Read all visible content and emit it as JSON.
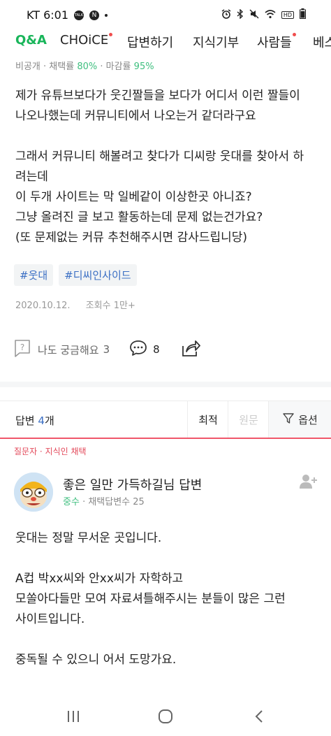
{
  "status_bar": {
    "carrier_time": "KT 6:01",
    "app_icons": [
      "TALK",
      "N"
    ],
    "right_icons": [
      "alarm-icon",
      "bluetooth-icon",
      "mute-icon",
      "wifi-icon",
      "hd-icon",
      "battery-icon"
    ],
    "hd_label": "HD"
  },
  "tabs": [
    {
      "label": "Q&A",
      "active": true,
      "dot": false
    },
    {
      "label": "CHOiCE",
      "active": false,
      "dot": true
    },
    {
      "label": "답변하기",
      "active": false,
      "dot": false
    },
    {
      "label": "지식기부",
      "active": false,
      "dot": false
    },
    {
      "label": "사람들",
      "active": false,
      "dot": true
    },
    {
      "label": "베스",
      "active": false,
      "dot": false
    }
  ],
  "question_stats": {
    "visibility": "비공개",
    "adoption_label": "채택률",
    "adoption_value": "80%",
    "deadline_label": "마감률",
    "deadline_value": "95%"
  },
  "question_body": [
    "제가 유튜브보다가 웃긴짤들을 보다가 어디서 이런 짤들이",
    "나오나했는데 커뮤니티에서 나오는거 같더라구요",
    "",
    "그래서 커뮤니티 해볼려고 찾다가 디씨랑 웃대를 찾아서 하",
    "려는데",
    "이 두개 사이트는 막 일베같이 이상한곳 아니죠?",
    "그냥 올려진 글 보고 활동하는데 문제 없는건가요?",
    "(또 문제없는 커뮤 추천해주시면 감사드립니당)"
  ],
  "hashtags": [
    "#웃대",
    "#디씨인사이드"
  ],
  "meta": {
    "date": "2020.10.12.",
    "views": "조회수 1만+"
  },
  "actions": {
    "curious_label": "나도 궁금해요",
    "curious_count": "3",
    "comment_count": "8"
  },
  "answers_bar": {
    "label_prefix": "답변",
    "count": "4",
    "label_suffix": "개",
    "sort_options": [
      "최적",
      "원문"
    ],
    "options_label": "옵션"
  },
  "answer": {
    "chosen_label": "질문자 · 지식인 채택",
    "author_name": "좋은 일만 가득하길님 답변",
    "level": "중수",
    "adopted_label": "채택답변수",
    "adopted_count": "25",
    "body": [
      "웃대는 정말 무서운 곳입니다.",
      "",
      "A컵 박xx씨와 안xx씨가 자학하고",
      "모쏠아다들만 모여 자료셔틀해주시는 분들이 많은 그런",
      "사이트입니다.",
      "",
      "중독될 수 있으니 어서 도망가요."
    ]
  },
  "nav_bar": {
    "buttons": [
      "recent-apps-icon",
      "home-icon",
      "back-icon"
    ]
  }
}
